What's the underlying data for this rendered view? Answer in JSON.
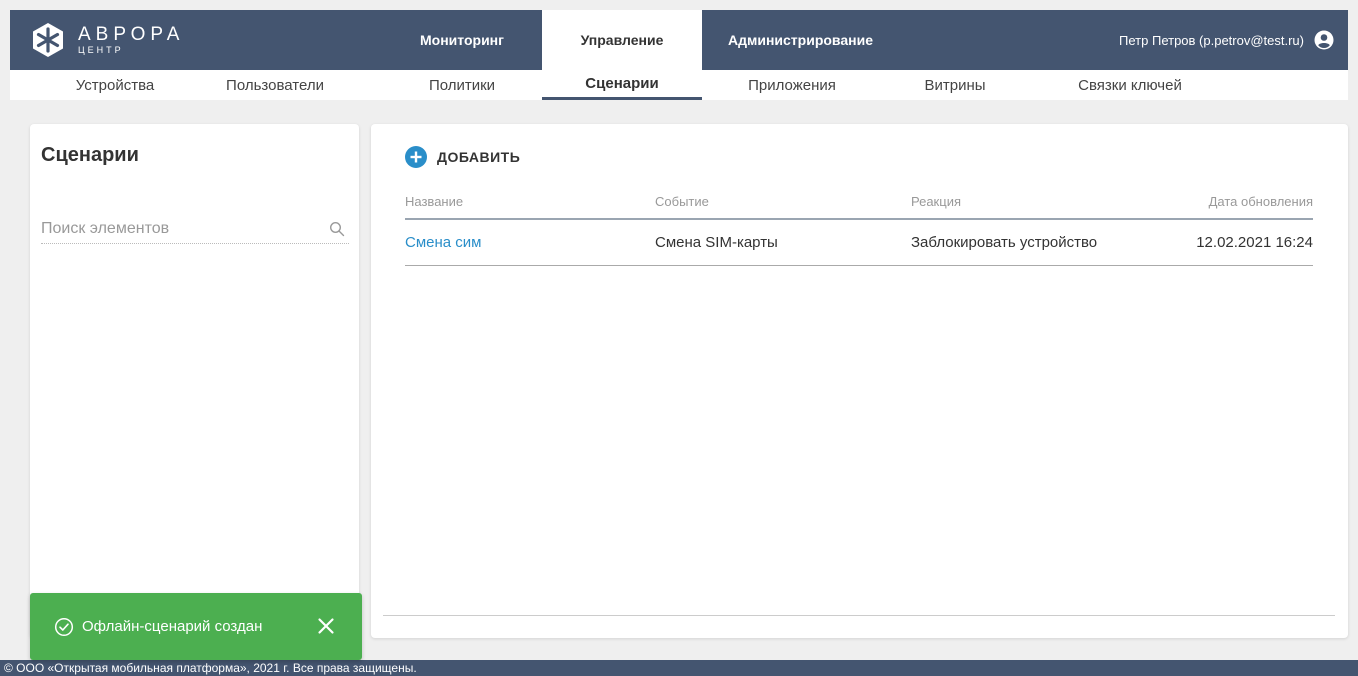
{
  "header": {
    "logo_title": "АВРОРА",
    "logo_sub": "ЦЕНТР",
    "tabs": [
      {
        "label": "Мониторинг"
      },
      {
        "label": "Управление"
      },
      {
        "label": "Администрирование"
      }
    ],
    "user_label": "Петр Петров (p.petrov@test.ru)"
  },
  "subnav": {
    "items": [
      {
        "label": "Устройства"
      },
      {
        "label": "Пользователи"
      },
      {
        "label": "Политики"
      },
      {
        "label": "Сценарии"
      },
      {
        "label": "Приложения"
      },
      {
        "label": "Витрины"
      },
      {
        "label": "Связки ключей"
      }
    ],
    "active": "Сценарии"
  },
  "sidebar": {
    "title": "Сценарии",
    "search_placeholder": "Поиск элементов"
  },
  "main": {
    "add_label": "ДОБАВИТЬ",
    "columns": [
      "Название",
      "Событие",
      "Реакция",
      "Дата обновления"
    ],
    "rows": [
      {
        "name": "Смена сим",
        "event": "Смена SIM-карты",
        "reaction": "Заблокировать устройство",
        "date": "12.02.2021 16:24"
      }
    ]
  },
  "toast": {
    "message": "Офлайн-сценарий создан"
  },
  "footer": {
    "text": "© ООО «Открытая мобильная платформа», 2021 г. Все права защищены."
  },
  "colors": {
    "header_bg": "#445570",
    "accent_blue": "#2a8ec9",
    "toast_green": "#4caf50"
  },
  "icons": {
    "logo": "snowflake-logo-icon",
    "user": "account-circle-icon",
    "search": "search-icon",
    "add": "plus-circle-icon",
    "toast_check": "check-circle-icon",
    "toast_close": "close-icon"
  }
}
